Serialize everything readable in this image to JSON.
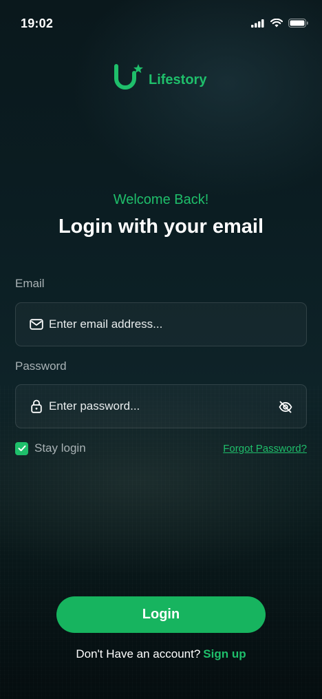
{
  "status_bar": {
    "time": "19:02"
  },
  "brand": {
    "name": "Lifestory",
    "accent_color": "#1fbf6b"
  },
  "welcome": {
    "kicker": "Welcome Back!",
    "title": "Login with your email"
  },
  "email": {
    "label": "Email",
    "placeholder": "Enter email address...",
    "icon": "mail-icon"
  },
  "password": {
    "label": "Password",
    "placeholder": "Enter password...",
    "icon": "lock-icon",
    "toggle_icon": "eye-off-icon"
  },
  "options": {
    "stay_login_label": "Stay login",
    "stay_login_checked": true,
    "forgot_password": "Forgot Password?"
  },
  "actions": {
    "login_label": "Login",
    "signup_prompt": "Don't Have an account?",
    "signup_link": "Sign up"
  }
}
